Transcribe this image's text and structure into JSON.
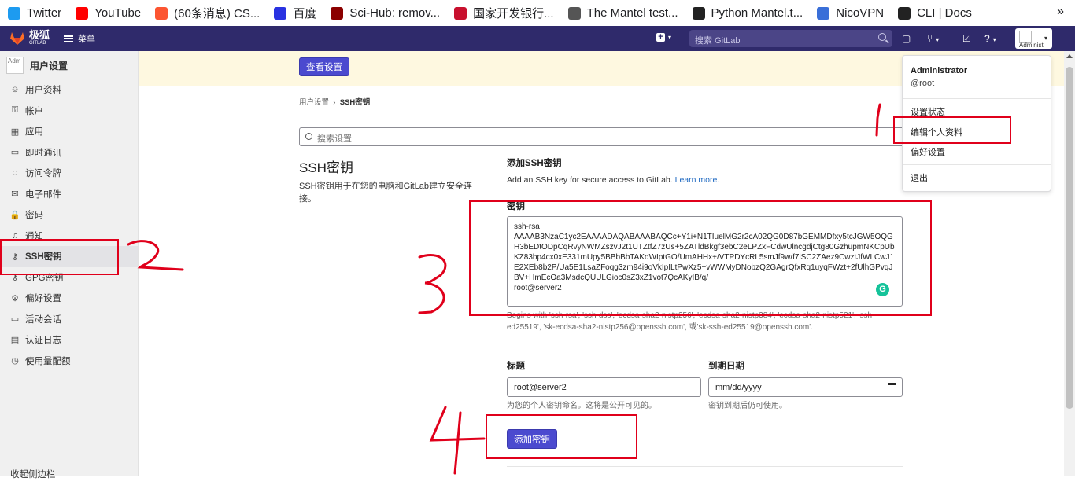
{
  "bookmarks": [
    {
      "label": "Twitter",
      "icon": "twitter-icon",
      "color": "#1d9bf0"
    },
    {
      "label": "YouTube",
      "icon": "youtube-icon",
      "color": "#ff0000"
    },
    {
      "label": "(60条消息) CS...",
      "icon": "csdn-icon",
      "color": "#fc5531"
    },
    {
      "label": "百度",
      "icon": "baidu-icon",
      "color": "#2932e1"
    },
    {
      "label": "Sci-Hub: remov...",
      "icon": "scihub-icon",
      "color": "#8b0000"
    },
    {
      "label": "国家开发银行...",
      "icon": "cdb-icon",
      "color": "#c8102e"
    },
    {
      "label": "The Mantel test...",
      "icon": "globe-icon",
      "color": "#555555"
    },
    {
      "label": "Python Mantel.t...",
      "icon": "pypi-icon",
      "color": "#222222"
    },
    {
      "label": "NicoVPN",
      "icon": "nicovpn-icon",
      "color": "#3a6fd8"
    },
    {
      "label": "CLI | Docs",
      "icon": "docs-icon",
      "color": "#222222"
    }
  ],
  "topnav": {
    "brand": "极狐",
    "brand_sub": "GITLAB",
    "menu_label": "菜单",
    "search_placeholder": "搜索 GitLab",
    "avatar_alt": "Administ",
    "bg_color": "#2f2a6b"
  },
  "sidebar": {
    "avatar_alt": "Adm",
    "title": "用户设置",
    "items": [
      {
        "label": "用户资料",
        "icon": "profile-icon",
        "glyph": "☺"
      },
      {
        "label": "帐户",
        "icon": "account-icon",
        "glyph": "⚿"
      },
      {
        "label": "应用",
        "icon": "applications-icon",
        "glyph": "▦"
      },
      {
        "label": "即时通讯",
        "icon": "chat-icon",
        "glyph": "▭"
      },
      {
        "label": "访问令牌",
        "icon": "token-icon",
        "glyph": "◌"
      },
      {
        "label": "电子邮件",
        "icon": "mail-icon",
        "glyph": "✉"
      },
      {
        "label": "密码",
        "icon": "lock-icon",
        "glyph": "🔒"
      },
      {
        "label": "通知",
        "icon": "notification-icon",
        "glyph": "♫"
      },
      {
        "label": "SSH密钥",
        "icon": "key-icon",
        "glyph": "⚷",
        "active": true
      },
      {
        "label": "GPG密钥",
        "icon": "gpg-key-icon",
        "glyph": "⚷"
      },
      {
        "label": "偏好设置",
        "icon": "preferences-icon",
        "glyph": "⚙"
      },
      {
        "label": "活动会话",
        "icon": "sessions-icon",
        "glyph": "▭"
      },
      {
        "label": "认证日志",
        "icon": "log-icon",
        "glyph": "▤"
      },
      {
        "label": "使用量配额",
        "icon": "quota-icon",
        "glyph": "◷"
      }
    ],
    "collapse_label": "收起侧边栏"
  },
  "main": {
    "view_settings_button": "查看设置",
    "breadcrumb": {
      "parent": "用户设置",
      "current": "SSH密钥"
    },
    "search_placeholder": "搜索设置",
    "ssh_title": "SSH密钥",
    "ssh_desc": "SSH密钥用于在您的电脑和GitLab建立安全连接。",
    "add_title": "添加SSH密钥",
    "add_desc": "Add an SSH key for secure access to GitLab.",
    "learn_more": "Learn more.",
    "key_label": "密钥",
    "key_value": "ssh-rsa\nAAAAB3NzaC1yc2EAAAADAQABAAABAQCc+Y1i+N1TIuelMG2r2cA02QG0D87bGEMMDfxy5tcJGW5OQGH3bEDtODpCqRvyNWMZszvJ2t1UTZtfZ7zUs+5ZATldBkgf3ebC2eLPZxFCdwUlncgdjCtg80GzhupmNKCpUbKZ83bp4cx0xE331mUpy5BBbBbTAKdWIptGO/UmAHHx+/VTPDYcRL5smJf9w/f7lSC2ZAez9CwztJfWLCwJ1E2XEb8b2P/Ua5E1LsaZFoqg3zm94i9oVkIpILtPwXz5+vWWMyDNobzQ2GAgrQfxRq1uyqFWzt+2fUlhGPvqJBV+HmEcOa3MsdcQUULGioc0sZ3xZ1vot7QcAKyIB/q/\nroot@server2",
    "key_help": "Begins with 'ssh-rsa', 'ssh-dss', 'ecdsa-sha2-nistp256', 'ecdsa-sha2-nistp384', 'ecdsa-sha2-nistp521', 'ssh-ed25519', 'sk-ecdsa-sha2-nistp256@openssh.com', 或'sk-ssh-ed25519@openssh.com'.",
    "title_label": "标题",
    "title_value": "root@server2",
    "title_help": "为您的个人密钥命名。这将是公开可见的。",
    "expiry_label": "到期日期",
    "expiry_placeholder": "mm/dd/yyyy",
    "expiry_help": "密钥到期后仍可使用。",
    "add_button": "添加密钥"
  },
  "user_dropdown": {
    "name": "Administrator",
    "username": "@root",
    "items": [
      "设置状态",
      "编辑个人资料",
      "偏好设置",
      "退出"
    ]
  },
  "annotations": {
    "color": "#e0001b",
    "numbers": [
      "1",
      "2",
      "3",
      "4"
    ]
  }
}
